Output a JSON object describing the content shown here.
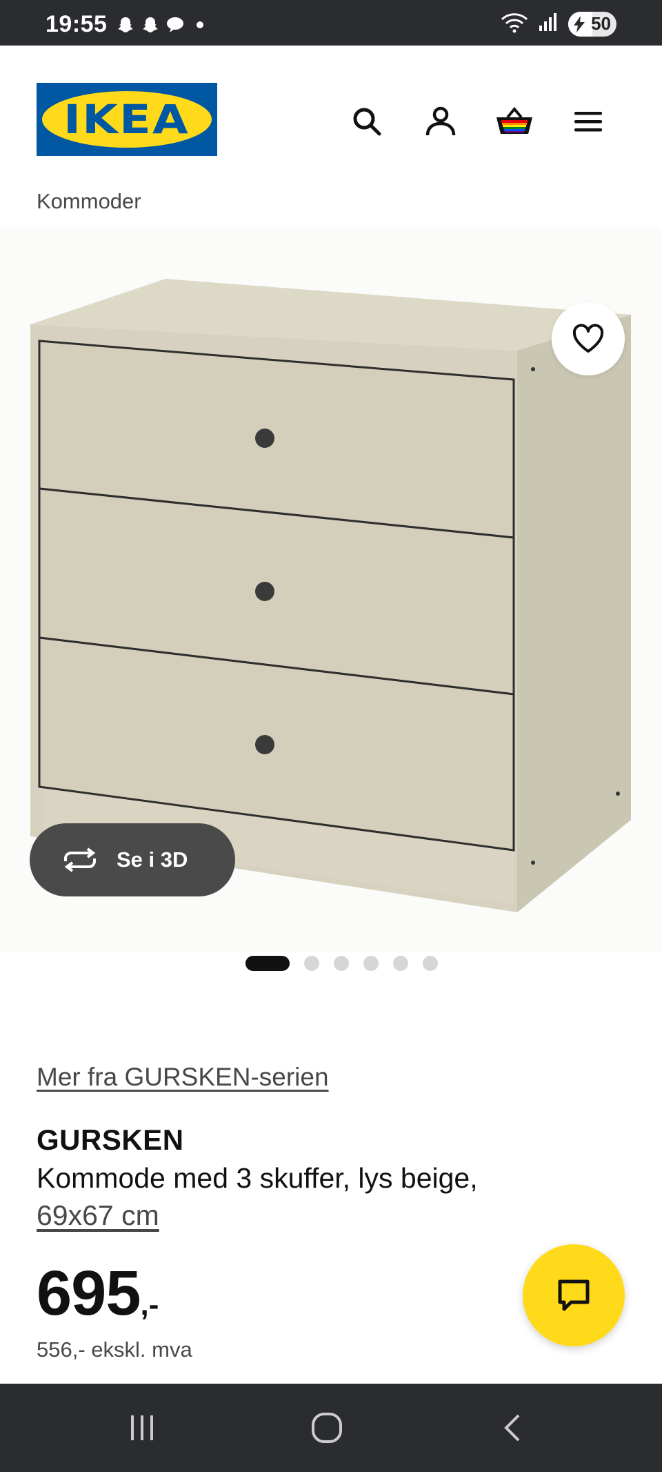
{
  "status_bar": {
    "time": "19:55",
    "left_icons": [
      "snapchat-icon",
      "snapchat-icon",
      "chat-bubble-icon",
      "dot-icon"
    ],
    "right_icons": [
      "wifi-icon",
      "signal-icon"
    ],
    "battery_level": "50"
  },
  "header": {
    "logo_text": "IKEA",
    "icons": [
      "search-icon",
      "profile-icon",
      "basket-icon",
      "menu-icon"
    ]
  },
  "breadcrumb": "Kommoder",
  "gallery": {
    "view_3d_label": "Se i 3D",
    "image_count": 6,
    "active_index": 0
  },
  "product": {
    "series_link": "Mer fra GURSKEN-serien",
    "name": "GURSKEN",
    "description": "Kommode med 3 skuffer, lys beige,",
    "size": "69x67 cm",
    "price_main": "695",
    "price_suffix": ",-",
    "price_excl": "556,- ekskl. mva"
  },
  "colors": {
    "ikea_blue": "#0058a3",
    "ikea_yellow": "#ffda1a",
    "system_bar": "#2b2c30"
  }
}
